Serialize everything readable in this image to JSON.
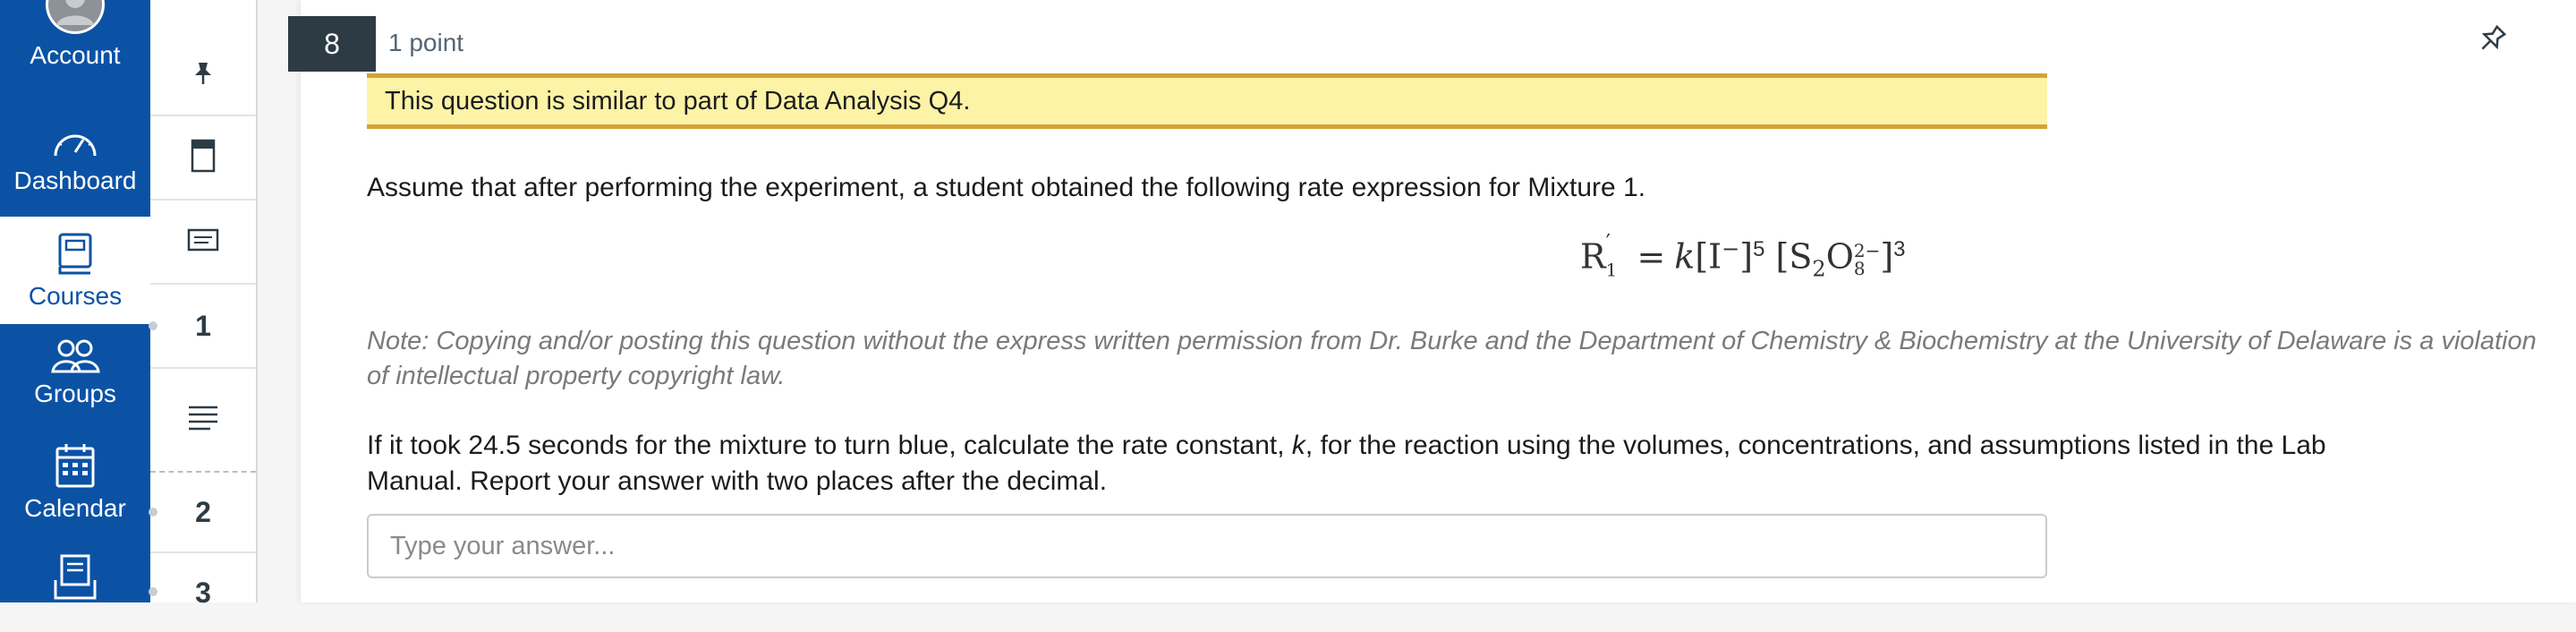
{
  "global_nav": {
    "items": [
      {
        "label": "Account",
        "icon": "user-avatar-icon"
      },
      {
        "label": "Dashboard",
        "icon": "dashboard-gauge-icon"
      },
      {
        "label": "Courses",
        "icon": "courses-book-icon",
        "active": true
      },
      {
        "label": "Groups",
        "icon": "groups-people-icon"
      },
      {
        "label": "Calendar",
        "icon": "calendar-icon"
      },
      {
        "label": "",
        "icon": "inbox-icon"
      }
    ],
    "colors": {
      "background": "#0b52a5",
      "active_background": "#ffffff"
    }
  },
  "quiz_nav": {
    "icons": [
      "pin-icon",
      "calculator-icon",
      "notepad-icon",
      "text-lines-icon"
    ],
    "question_numbers": [
      "1",
      "2",
      "3"
    ]
  },
  "question": {
    "number": "8",
    "points": "1 point",
    "highlight": "This question is similar to part of Data Analysis Q4.",
    "intro": "Assume that after performing the experiment, a student obtained the following rate expression for Mixture 1.",
    "equation": {
      "lhs": "R",
      "lhs_sub": "1",
      "lhs_prime": "′",
      "equals": "=",
      "k": "k",
      "iodide": "I",
      "iodide_charge": "−",
      "iodide_order": "5",
      "persulfate_s": "S",
      "persulfate_s_sub": "2",
      "persulfate_o": "O",
      "persulfate_o_sub": "8",
      "persulfate_charge": "2−",
      "persulfate_order": "3"
    },
    "note": "Note: Copying and/or posting this question without the express written permission from Dr. Burke and the Department of Chemistry & Biochemistry at the University of Delaware is a violation of intellectual property copyright law.",
    "prompt_part1": "If it took 24.5 seconds for the mixture to turn blue, calculate the rate constant, ",
    "prompt_k": "k",
    "prompt_part2": ", for the reaction using the volumes, concentrations, and assumptions listed in the Lab",
    "prompt_line2": "Manual. Report your answer with two places after the decimal.",
    "answer_placeholder": "Type your answer...",
    "answer_value": ""
  }
}
